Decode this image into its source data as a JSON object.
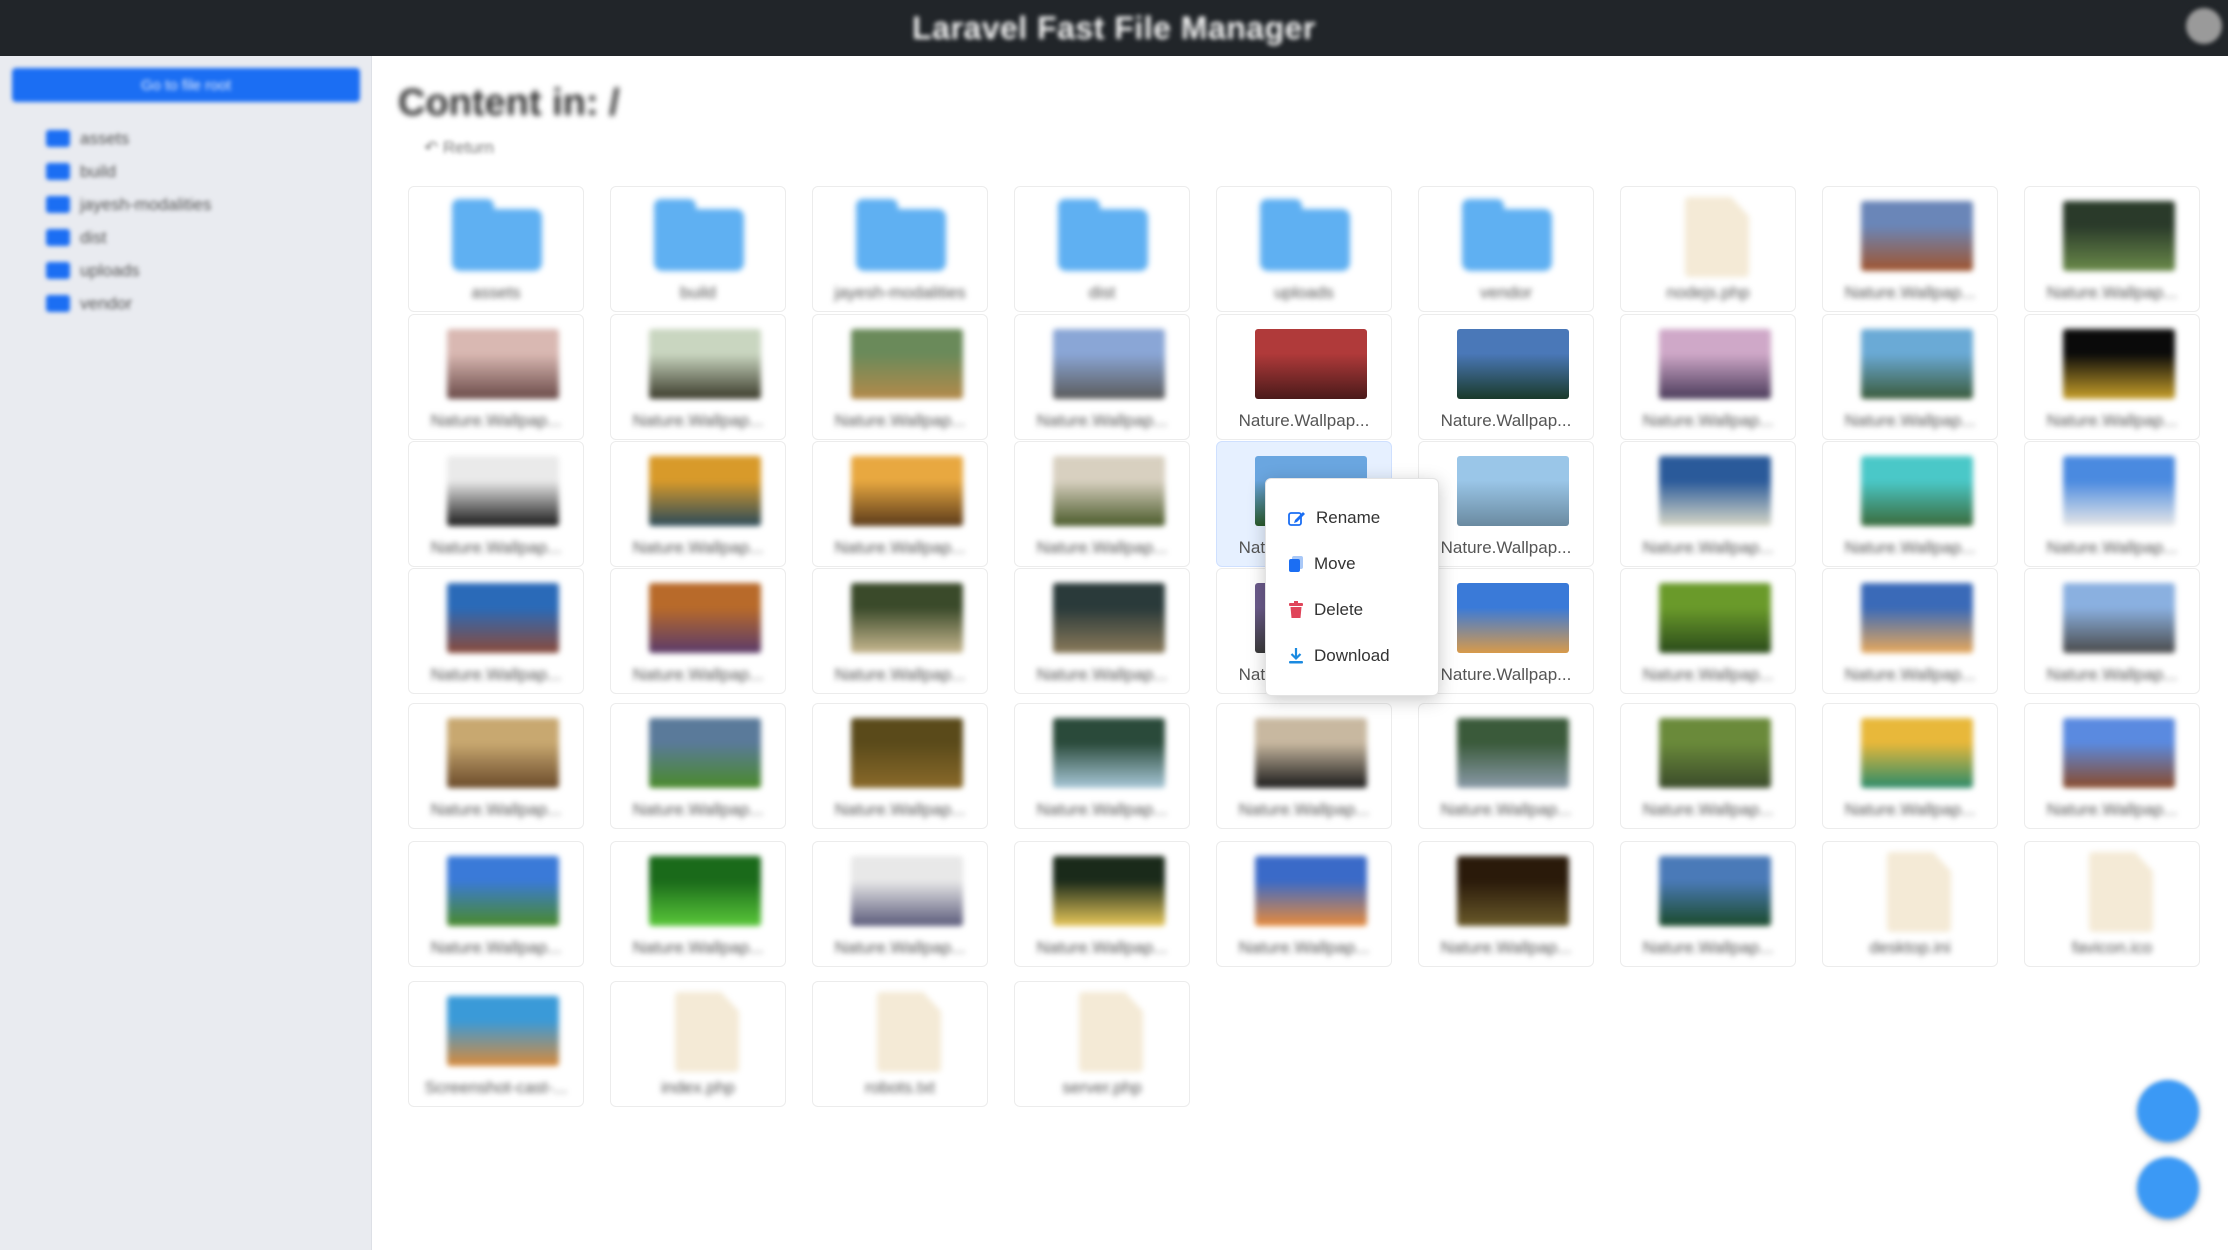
{
  "app": {
    "title": "Laravel Fast File Manager"
  },
  "sidebar": {
    "new_button": "Go to file root",
    "tree": [
      "assets",
      "build",
      "jayesh-modalities",
      "dist",
      "uploads",
      "vendor"
    ]
  },
  "main": {
    "heading": "Content in: /",
    "return_label": "Return"
  },
  "grid": {
    "items": [
      {
        "type": "folder",
        "label": "assets"
      },
      {
        "type": "folder",
        "label": "build"
      },
      {
        "type": "folder",
        "label": "jayesh-modalities"
      },
      {
        "type": "folder",
        "label": "dist"
      },
      {
        "type": "folder",
        "label": "uploads"
      },
      {
        "type": "folder",
        "label": "vendor"
      },
      {
        "type": "file",
        "label": "nodejs.php"
      },
      {
        "type": "image",
        "label": "Nature.Wallpap...",
        "colors": [
          "#6a86b8",
          "#a0542e"
        ]
      },
      {
        "type": "image",
        "label": "Nature.Wallpap...",
        "colors": [
          "#2a3a2a",
          "#6a8a4a"
        ]
      },
      {
        "type": "image",
        "label": "Nature.Wallpap...",
        "colors": [
          "#d9b8b2",
          "#6a4a48"
        ]
      },
      {
        "type": "image",
        "label": "Nature.Wallpap...",
        "colors": [
          "#c9d6c0",
          "#3a3a2a"
        ]
      },
      {
        "type": "image",
        "label": "Nature.Wallpap...",
        "colors": [
          "#6a8a5a",
          "#b48a4a"
        ]
      },
      {
        "type": "image",
        "label": "Nature.Wallpap...",
        "colors": [
          "#8aa6d6",
          "#5a5a5a"
        ]
      },
      {
        "type": "image",
        "label": "Nature.Wallpap...",
        "colors": [
          "#b03a3a",
          "#4a1a1a"
        ],
        "clear": true
      },
      {
        "type": "image",
        "label": "Nature.Wallpap...",
        "colors": [
          "#4a78b8",
          "#1a3a2a"
        ],
        "clear": true
      },
      {
        "type": "image",
        "label": "Nature.Wallpap...",
        "colors": [
          "#cfa8c8",
          "#4a3a5a"
        ]
      },
      {
        "type": "image",
        "label": "Nature.Wallpap...",
        "colors": [
          "#6aaad6",
          "#3a5a3a"
        ]
      },
      {
        "type": "image",
        "label": "Nature.Wallpap...",
        "colors": [
          "#0a0a0a",
          "#c8a02a"
        ]
      },
      {
        "type": "image",
        "label": "Nature.Wallpap...",
        "colors": [
          "#eaeaea",
          "#1a1a1a"
        ]
      },
      {
        "type": "image",
        "label": "Nature.Wallpap...",
        "colors": [
          "#d89a2a",
          "#2a4a5a"
        ]
      },
      {
        "type": "image",
        "label": "Nature.Wallpap...",
        "colors": [
          "#e8a840",
          "#5a3a1a"
        ]
      },
      {
        "type": "image",
        "label": "Nature.Wallpap...",
        "colors": [
          "#d8d0c0",
          "#4a5a2a"
        ]
      },
      {
        "type": "image",
        "label": "Nature.Wallpap...",
        "colors": [
          "#6aa6e0",
          "#2a5a2a"
        ],
        "clear": true,
        "selected": true
      },
      {
        "type": "image",
        "label": "Nature.Wallpap...",
        "colors": [
          "#9ac6e8",
          "#6a8aa0"
        ],
        "clear": true
      },
      {
        "type": "image",
        "label": "Nature.Wallpap...",
        "colors": [
          "#2a5a9a",
          "#d8d8c8"
        ]
      },
      {
        "type": "image",
        "label": "Nature.Wallpap...",
        "colors": [
          "#4ac8c8",
          "#3a6a3a"
        ]
      },
      {
        "type": "image",
        "label": "Nature.Wallpap...",
        "colors": [
          "#4a8ae0",
          "#e8e8e8"
        ]
      },
      {
        "type": "image",
        "label": "Nature.Wallpap...",
        "colors": [
          "#2a6ab8",
          "#8a4a3a"
        ]
      },
      {
        "type": "image",
        "label": "Nature.Wallpap...",
        "colors": [
          "#b86a2a",
          "#5a3a6a"
        ]
      },
      {
        "type": "image",
        "label": "Nature.Wallpap...",
        "colors": [
          "#3a4a2a",
          "#c8b890"
        ]
      },
      {
        "type": "image",
        "label": "Nature.Wallpap...",
        "colors": [
          "#2a3a3a",
          "#8a7a5a"
        ]
      },
      {
        "type": "image",
        "label": "Nature.Wallpap...",
        "colors": [
          "#6a5a8a",
          "#3a3a3a"
        ],
        "clear": true
      },
      {
        "type": "image",
        "label": "Nature.Wallpap...",
        "colors": [
          "#3a7ad8",
          "#d89a4a"
        ],
        "clear": true
      },
      {
        "type": "image",
        "label": "Nature.Wallpap...",
        "colors": [
          "#6a9a2a",
          "#2a4a1a"
        ]
      },
      {
        "type": "image",
        "label": "Nature.Wallpap...",
        "colors": [
          "#3a6ab8",
          "#e8a85a"
        ]
      },
      {
        "type": "image",
        "label": "Nature.Wallpap...",
        "colors": [
          "#8ab0e0",
          "#4a4a4a"
        ]
      },
      {
        "type": "image",
        "label": "Nature.Wallpap...",
        "colors": [
          "#c8a870",
          "#6a4a2a"
        ]
      },
      {
        "type": "image",
        "label": "Nature.Wallpap...",
        "colors": [
          "#5a7a9a",
          "#4a8a2a"
        ]
      },
      {
        "type": "image",
        "label": "Nature.Wallpap...",
        "colors": [
          "#5a4a1a",
          "#8a6a2a"
        ]
      },
      {
        "type": "image",
        "label": "Nature.Wallpap...",
        "colors": [
          "#2a4a3a",
          "#a8c8d8"
        ]
      },
      {
        "type": "image",
        "label": "Nature.Wallpap...",
        "colors": [
          "#c8b8a0",
          "#1a1a1a"
        ]
      },
      {
        "type": "image",
        "label": "Nature.Wallpap...",
        "colors": [
          "#3a5a3a",
          "#8a9aa8"
        ]
      },
      {
        "type": "image",
        "label": "Nature.Wallpap...",
        "colors": [
          "#6a8a3a",
          "#3a4a2a"
        ]
      },
      {
        "type": "image",
        "label": "Nature.Wallpap...",
        "colors": [
          "#e8b83a",
          "#2a8a6a"
        ]
      },
      {
        "type": "image",
        "label": "Nature.Wallpap...",
        "colors": [
          "#5a8ae0",
          "#8a4a2a"
        ]
      },
      {
        "type": "image",
        "label": "Nature.Wallpap...",
        "colors": [
          "#3a7ad8",
          "#4a8a2a"
        ]
      },
      {
        "type": "image",
        "label": "Nature.Wallpap...",
        "colors": [
          "#1a6a1a",
          "#5ac83a"
        ]
      },
      {
        "type": "image",
        "label": "Nature.Wallpap...",
        "colors": [
          "#e8e8e8",
          "#5a5a7a"
        ]
      },
      {
        "type": "image",
        "label": "Nature.Wallpap...",
        "colors": [
          "#1a2a1a",
          "#e8c85a"
        ]
      },
      {
        "type": "image",
        "label": "Nature.Wallpap...",
        "colors": [
          "#3a6ac8",
          "#e88a3a"
        ]
      },
      {
        "type": "image",
        "label": "Nature.Wallpap...",
        "colors": [
          "#2a1a0a",
          "#6a5a2a"
        ]
      },
      {
        "type": "image",
        "label": "Nature.Wallpap...",
        "colors": [
          "#4a7ab8",
          "#1a4a2a"
        ]
      },
      {
        "type": "file",
        "label": "desktop.ini"
      },
      {
        "type": "file",
        "label": "favicon.ico"
      },
      {
        "type": "image",
        "label": "Screenshot-cast-...",
        "colors": [
          "#3a9ad8",
          "#d88a3a"
        ]
      },
      {
        "type": "file",
        "label": "index.php"
      },
      {
        "type": "file",
        "label": "robots.txt"
      },
      {
        "type": "file",
        "label": "server.php"
      }
    ]
  },
  "context_menu": {
    "items": [
      {
        "label": "Rename",
        "icon": "rename-icon",
        "color": "#1b6ef3"
      },
      {
        "label": "Move",
        "icon": "move-icon",
        "color": "#1b6ef3"
      },
      {
        "label": "Delete",
        "icon": "delete-icon",
        "color": "#e0455a"
      },
      {
        "label": "Download",
        "icon": "download-icon",
        "color": "#1b8ae0"
      }
    ]
  },
  "fabs": [
    "new-folder-icon",
    "upload-icon"
  ]
}
